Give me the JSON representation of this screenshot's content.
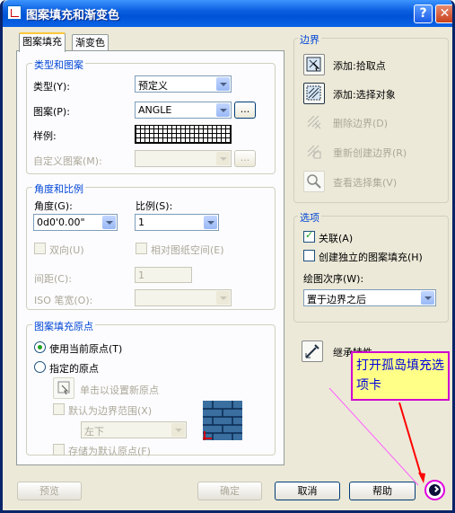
{
  "title": "图案填充和渐变色",
  "tabs": [
    "图案填充",
    "渐变色"
  ],
  "type_group": {
    "title": "类型和图案",
    "type_label": "类型(Y):",
    "type_value": "预定义",
    "pattern_label": "图案(P):",
    "pattern_value": "ANGLE",
    "pattern_more": "...",
    "swatch_label": "样例:",
    "custom_label": "自定义图案(M):",
    "custom_more": "..."
  },
  "angle_group": {
    "title": "角度和比例",
    "angle_label": "角度(G):",
    "angle_value": "0d0'0.00\"",
    "scale_label": "比例(S):",
    "scale_value": "1",
    "double_label": "双向(U)",
    "relative_label": "相对图纸空间(E)",
    "spacing_label": "间距(C):",
    "spacing_value": "1",
    "iso_label": "ISO 笔宽(O):"
  },
  "origin_group": {
    "title": "图案填充原点",
    "current_label": "使用当前原点(T)",
    "specified_label": "指定的原点",
    "click_label": "单击以设置新原点",
    "default_bounds_label": "默认为边界范围(X)",
    "bounds_value": "左下",
    "store_label": "存储为默认原点(F)"
  },
  "boundary_group": {
    "title": "边界",
    "pick_label": "添加:拾取点",
    "select_label": "添加:选择对象",
    "remove_label": "删除边界(D)",
    "recreate_label": "重新创建边界(R)",
    "view_label": "查看选择集(V)"
  },
  "options_group": {
    "title": "选项",
    "assoc_label": "关联(A)",
    "separate_label": "创建独立的图案填充(H)",
    "draw_order_label": "绘图次序(W):",
    "draw_order_value": "置于边界之后"
  },
  "inherit_label": "继承特性",
  "buttons": {
    "preview": "预览",
    "ok": "确定",
    "cancel": "取消",
    "help": "帮助"
  },
  "callout_text": "打开孤岛填充选项卡",
  "colors": {
    "accent": "#0046d5",
    "annotation_border": "#d000d0",
    "annotation_bg": "#ffff88",
    "arrow": "#ff0000"
  }
}
